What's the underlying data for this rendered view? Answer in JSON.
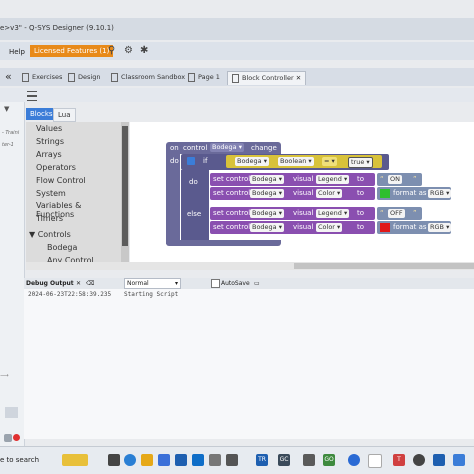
{
  "window": {
    "title": "e>v3\" - Q-SYS Designer (9.10.1)"
  },
  "menu": {
    "help": "Help",
    "licensed": "Licensed Features (1)"
  },
  "tabs": [
    {
      "label": "Exercises"
    },
    {
      "label": "Design"
    },
    {
      "label": "Classroom Sandbox"
    },
    {
      "label": "Page 1"
    },
    {
      "label": "Block Controller"
    }
  ],
  "left_strip": {
    "text1": "- Traini",
    "text2": "ter-1"
  },
  "blocks_tabs": {
    "blocks": "Blocks",
    "lua": "Lua"
  },
  "categories": [
    "Values",
    "Strings",
    "Arrays",
    "Operators",
    "Flow Control",
    "System",
    "Variables & Functions",
    "Timers"
  ],
  "controls": {
    "header": "Controls",
    "items": [
      "Bodega",
      "Any Control"
    ]
  },
  "workspace": {
    "event": {
      "on": "on",
      "control": "control",
      "name": "Bodega",
      "change": "change"
    },
    "do": "do",
    "if": "if",
    "cond": {
      "control": "Bodega",
      "type": "Boolean",
      "op": "=",
      "value": "true"
    },
    "branch_do": "do",
    "branch_else": "else",
    "set_rows": [
      {
        "set": "set control",
        "control": "Bodega",
        "visual": "visual",
        "prop": "Legend",
        "to": "to",
        "value": "ON",
        "kind": "text"
      },
      {
        "set": "set control",
        "control": "Bodega",
        "visual": "visual",
        "prop": "Color",
        "to": "to",
        "format": "format as",
        "fmt": "RGB",
        "color": "#2fbf2f",
        "kind": "color"
      },
      {
        "set": "set control",
        "control": "Bodega",
        "visual": "visual",
        "prop": "Legend",
        "to": "to",
        "value": "OFF",
        "kind": "text"
      },
      {
        "set": "set control",
        "control": "Bodega",
        "visual": "visual",
        "prop": "Color",
        "to": "to",
        "format": "format as",
        "fmt": "RGB",
        "color": "#e01818",
        "kind": "color"
      }
    ]
  },
  "debug": {
    "label": "Debug Output",
    "level": "Normal",
    "autosave": "AutoSave",
    "line_time": "2024-06-23T22:58:39.235",
    "line_msg": "Starting Script"
  },
  "taskbar": {
    "search_text": "e to search",
    "apps": [
      "TR",
      "GC",
      "GO",
      "T"
    ]
  },
  "colors": {
    "event_block": "#6a6a9a",
    "if_block": "#5a5a8e",
    "cond_yellow": "#d8c23a",
    "set_block": "#8a4fb0",
    "accent_blue": "#3b7dd8",
    "licensed_orange": "#e88a1a"
  }
}
